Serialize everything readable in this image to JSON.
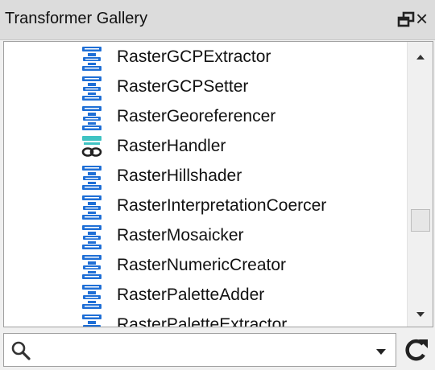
{
  "panel": {
    "title": "Transformer Gallery"
  },
  "window_controls": {
    "float_icon": "float-restore-icon",
    "close_label": "×"
  },
  "list": {
    "items": [
      {
        "label": "RasterGCPExtractor",
        "icon": "transformer-icon"
      },
      {
        "label": "RasterGCPSetter",
        "icon": "transformer-icon"
      },
      {
        "label": "RasterGeoreferencer",
        "icon": "transformer-icon"
      },
      {
        "label": "RasterHandler",
        "icon": "link-transformer-icon"
      },
      {
        "label": "RasterHillshader",
        "icon": "transformer-icon"
      },
      {
        "label": "RasterInterpretationCoercer",
        "icon": "transformer-icon"
      },
      {
        "label": "RasterMosaicker",
        "icon": "transformer-icon"
      },
      {
        "label": "RasterNumericCreator",
        "icon": "transformer-icon"
      },
      {
        "label": "RasterPaletteAdder",
        "icon": "transformer-icon"
      },
      {
        "label": "RasterPaletteExtractor",
        "icon": "transformer-icon"
      }
    ]
  },
  "scrollbar": {
    "position_fraction": 0.62
  },
  "search": {
    "value": "",
    "placeholder": ""
  },
  "colors": {
    "icon_blue": "#1f6fd6",
    "icon_teal": "#3fc3c3",
    "titlebar_bg": "#dcdcdc"
  }
}
